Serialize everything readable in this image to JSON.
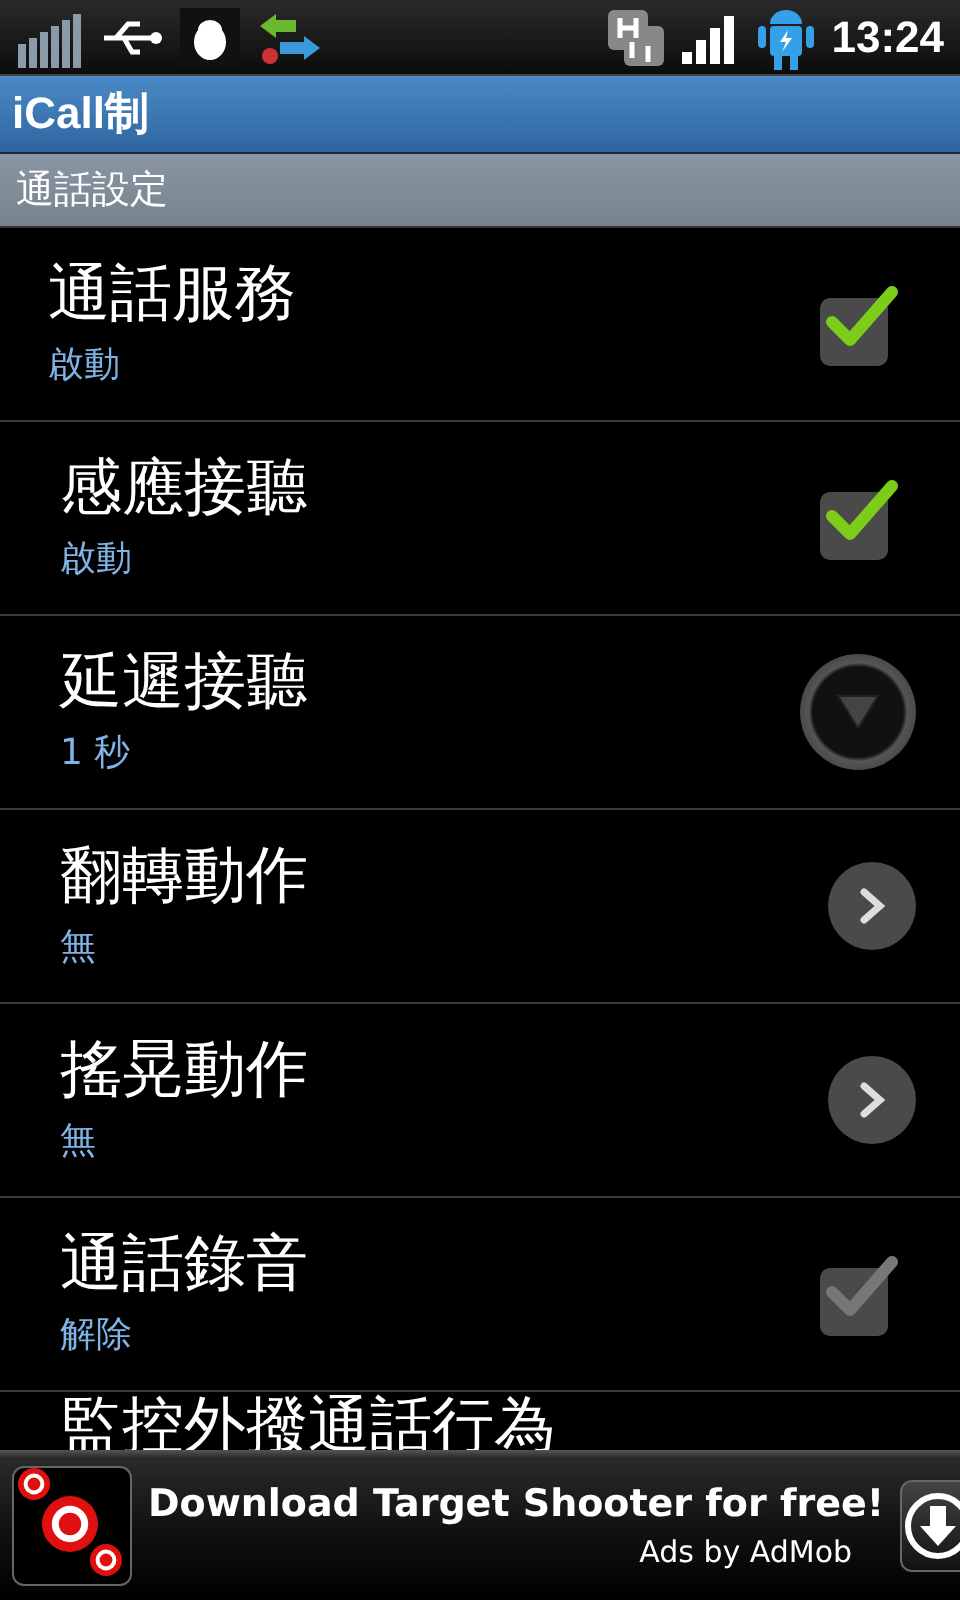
{
  "status_bar": {
    "time": "13:24"
  },
  "title_bar": {
    "title": "iCall制"
  },
  "section_header": "通話設定",
  "settings": [
    {
      "title": "通話服務",
      "summary": "啟動",
      "kind": "checkbox",
      "checked": true,
      "disabled": false,
      "indented": false
    },
    {
      "title": "感應接聽",
      "summary": "啟動",
      "kind": "checkbox",
      "checked": true,
      "disabled": false,
      "indented": true
    },
    {
      "title": "延遲接聽",
      "summary": "1 秒",
      "kind": "dropdown",
      "indented": true
    },
    {
      "title": "翻轉動作",
      "summary": "無",
      "kind": "chevron",
      "indented": true
    },
    {
      "title": "搖晃動作",
      "summary": "無",
      "kind": "chevron",
      "indented": true
    },
    {
      "title": "通話錄音",
      "summary": "解除",
      "kind": "checkbox",
      "checked": true,
      "disabled": true,
      "indented": true
    },
    {
      "title": "監控外撥通話行為",
      "kind": "partial"
    }
  ],
  "ad_banner": {
    "headline": "Download Target Shooter for free!",
    "attribution": "Ads by AdMob"
  }
}
